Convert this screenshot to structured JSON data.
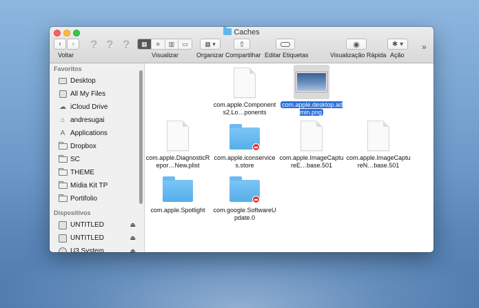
{
  "window": {
    "title": "Caches"
  },
  "toolbar": {
    "back_label": "Voltar",
    "view_label": "Visualizar",
    "arrange_label": "Organizar",
    "share_label": "Compartilhar",
    "tags_label": "Editar Etiquetas",
    "quicklook_label": "Visualização Rápida",
    "action_label": "Ação",
    "overflow": "»",
    "unknown_glyph": "?"
  },
  "sidebar": {
    "favorites_header": "Favoritos",
    "favorites": [
      {
        "label": "Desktop",
        "icon": "desktop-icon"
      },
      {
        "label": "All My Files",
        "icon": "all-files-icon"
      },
      {
        "label": "iCloud Drive",
        "icon": "cloud-icon"
      },
      {
        "label": "andresugai",
        "icon": "home-icon"
      },
      {
        "label": "Applications",
        "icon": "applications-icon"
      },
      {
        "label": "Dropbox",
        "icon": "folder-icon"
      },
      {
        "label": "SC",
        "icon": "folder-icon"
      },
      {
        "label": "THEME",
        "icon": "folder-icon"
      },
      {
        "label": "Mídia Kit TP",
        "icon": "folder-icon"
      },
      {
        "label": "Portifolio",
        "icon": "folder-icon"
      }
    ],
    "devices_header": "Dispositivos",
    "devices": [
      {
        "label": "UNTITLED",
        "eject": "⏏"
      },
      {
        "label": "UNTITLED",
        "eject": "⏏"
      },
      {
        "label": "U3 System",
        "eject": "⏏"
      }
    ]
  },
  "files": [
    {
      "name": "com.apple.Components2.Lo…ponents",
      "kind": "document"
    },
    {
      "name": "com.apple.desktop.admin.png",
      "kind": "image",
      "selected": true
    },
    {
      "name": "com.apple.DiagnosticRepor…New.plist",
      "kind": "document"
    },
    {
      "name": "com.apple.iconservices.store",
      "kind": "locked-folder"
    },
    {
      "name": "com.apple.ImageCaptureE…base.501",
      "kind": "document"
    },
    {
      "name": "com.apple.ImageCaptureN…base.501",
      "kind": "document"
    },
    {
      "name": "com.apple.Spotlight",
      "kind": "folder"
    },
    {
      "name": "com.google.SoftwareUpdate.0",
      "kind": "locked-folder"
    }
  ]
}
